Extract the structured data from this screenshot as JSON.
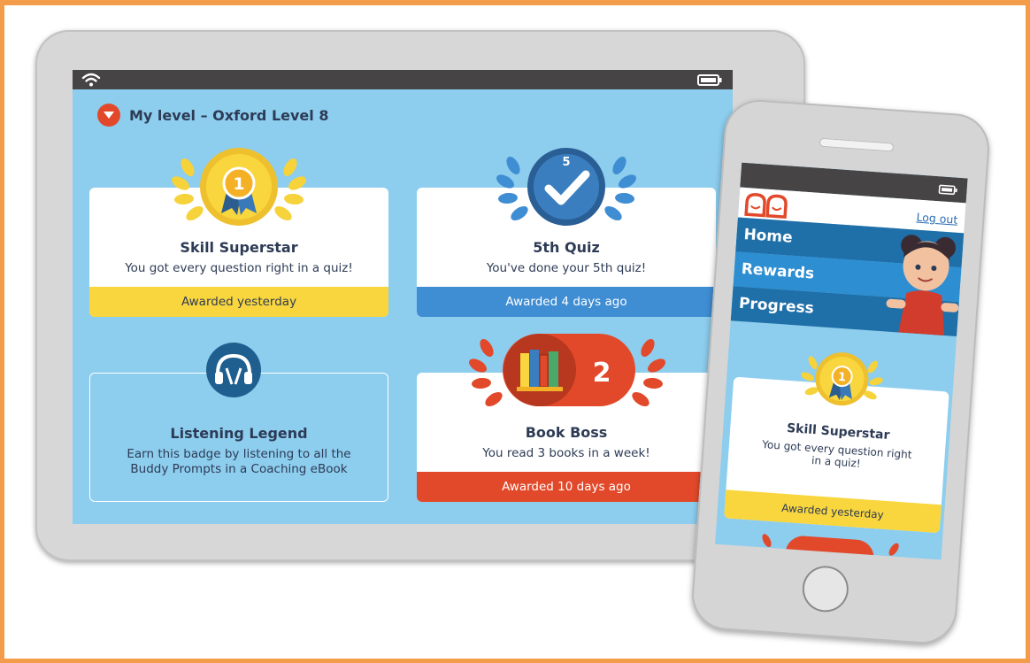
{
  "tablet": {
    "level_title": "My level – Oxford Level 8",
    "cards": [
      {
        "title": "Skill Superstar",
        "description": "You got every question right in a quiz!",
        "footer": "Awarded yesterday",
        "footer_color": "#f9d63d"
      },
      {
        "title": "5th Quiz",
        "badge_number": "5",
        "description": "You've done your 5th quiz!",
        "footer": "Awarded 4 days ago",
        "footer_color": "#3f8dd3"
      },
      {
        "title": "Listening Legend",
        "description_line1": "Earn this badge by listening to all the",
        "description_line2": "Buddy Prompts in a Coaching eBook"
      },
      {
        "title": "Book Boss",
        "badge_number": "2",
        "description": "You read 3 books in a week!",
        "footer": "Awarded 10 days ago",
        "footer_color": "#e2492a"
      }
    ]
  },
  "phone": {
    "logout_label": "Log out",
    "menu": [
      {
        "label": "Home",
        "color": "#1f6fa8"
      },
      {
        "label": "Rewards",
        "color": "#2d8ed2"
      },
      {
        "label": "Progress",
        "color": "#1f6fa8"
      }
    ],
    "card": {
      "title": "Skill Superstar",
      "description_line1": "You got every question right",
      "description_line2": "in a quiz!",
      "footer": "Awarded yesterday"
    }
  },
  "icons": [
    "wifi-icon",
    "battery-icon",
    "chevron-down-icon",
    "gold-medal-icon",
    "checkmark-badge-icon",
    "headphones-icon",
    "books-icon",
    "laurel-icon",
    "logo-icon",
    "character-illustration"
  ]
}
